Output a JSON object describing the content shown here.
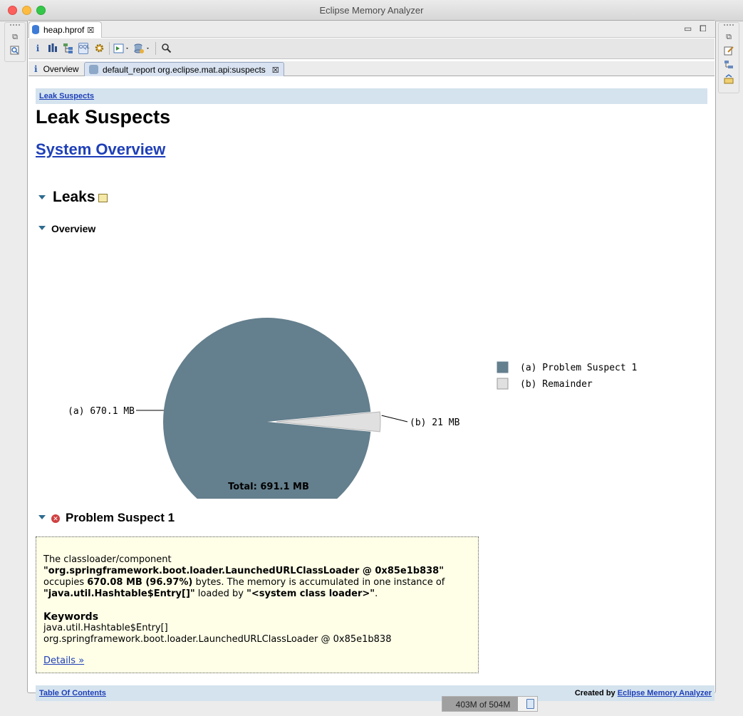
{
  "window": {
    "title": "Eclipse Memory Analyzer"
  },
  "editor_tab": {
    "label": "heap.hprof",
    "close": "☒"
  },
  "window_controls": {
    "minimize": "▭",
    "maximize": "⧠"
  },
  "toolbar": {
    "info_icon": "i",
    "items": [
      "histogram-icon",
      "dominator-tree-icon",
      "oql-icon",
      "gear-icon",
      "run-report-icon",
      "query-browser-icon",
      "search-icon"
    ],
    "oql_label": "OQL"
  },
  "inner_tabs": {
    "overview_icon": "i",
    "overview_label": "Overview",
    "report_label": "default_report  org.eclipse.mat.api:suspects",
    "close": "☒"
  },
  "report": {
    "breadcrumb": "Leak Suspects",
    "title": "Leak Suspects",
    "system_overview": "System Overview",
    "leaks_heading": "Leaks",
    "overview_heading": "Overview",
    "suspect_heading": "Problem Suspect 1",
    "suspect": {
      "intro": "The classloader/component",
      "classloader": "\"org.springframework.boot.loader.LaunchedURLClassLoader @ 0x85e1b838\"",
      "occupies": "occupies",
      "size": "670.08 MB (96.97%)",
      "bytes_text": "bytes. The memory is accumulated in one instance of",
      "instance_class": "\"java.util.Hashtable$Entry[]\"",
      "loaded_by": "loaded by",
      "loader": "\"<system class loader>\"",
      "period": ".",
      "keywords_heading": "Keywords",
      "keywords": [
        "java.util.Hashtable$Entry[]",
        "org.springframework.boot.loader.LaunchedURLClassLoader @ 0x85e1b838"
      ],
      "details_link": "Details »"
    },
    "footer": {
      "toc": "Table Of Contents",
      "created_by": "Created by",
      "created_link": "Eclipse Memory Analyzer"
    }
  },
  "chart_data": {
    "type": "pie",
    "unit": "MB",
    "slices": [
      {
        "label": "(a)",
        "legend": "(a)  Problem Suspect 1",
        "value": 670.1,
        "value_label": "(a)  670.1 MB",
        "color": "#647f8d"
      },
      {
        "label": "(b)",
        "legend": "(b)  Remainder",
        "value": 21,
        "value_label": "(b)  21 MB",
        "color": "#e0e0e0"
      }
    ],
    "total_label": "Total: 691.1 MB"
  },
  "status": {
    "heap_text": "403M of 504M",
    "heap_used_fraction": 0.8
  },
  "side_trims": {
    "left": [
      "restore-icon",
      "search-icon"
    ],
    "right": [
      "restore-icon",
      "notes-icon",
      "navigation-icon",
      "compare-icon"
    ]
  }
}
